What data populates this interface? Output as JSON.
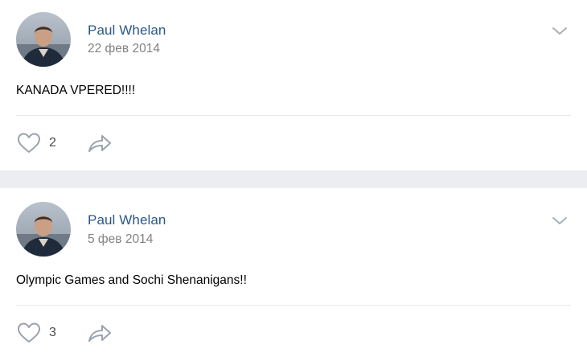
{
  "posts": [
    {
      "author": "Paul Whelan",
      "date": "22 фев 2014",
      "text": "KANADA VPERED!!!!",
      "likes": "2",
      "avatar_icon": "user-photo",
      "menu_icon": "chevron-down-icon",
      "like_icon": "heart-outline-icon",
      "share_icon": "share-arrow-icon"
    },
    {
      "author": "Paul Whelan",
      "date": "5 фев 2014",
      "text": "Olympic Games and Sochi Shenanigans!!",
      "likes": "3",
      "avatar_icon": "user-photo",
      "menu_icon": "chevron-down-icon",
      "like_icon": "heart-outline-icon",
      "share_icon": "share-arrow-icon"
    }
  ],
  "colors": {
    "author": "#2a5885",
    "date": "#828282",
    "icon": "#9aa3ad",
    "separator": "#ebedf0"
  }
}
